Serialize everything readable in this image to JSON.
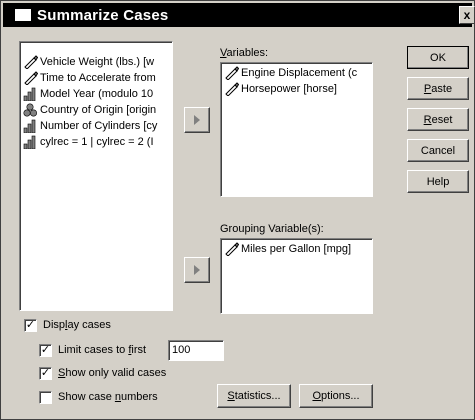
{
  "window": {
    "title": "Summarize Cases",
    "close_glyph": "x"
  },
  "source_list": {
    "items": [
      {
        "label": "Vehicle Weight (lbs.) [w",
        "icon": "scale-icon"
      },
      {
        "label": "Time to Accelerate from",
        "icon": "scale-icon"
      },
      {
        "label": "Model Year (modulo 10",
        "icon": "ordinal-icon"
      },
      {
        "label": "Country of Origin [origin",
        "icon": "nominal-icon"
      },
      {
        "label": "Number of Cylinders [cy",
        "icon": "ordinal-icon"
      },
      {
        "label": "cylrec = 1 | cylrec = 2 (I",
        "icon": "ordinal-icon"
      }
    ]
  },
  "variables": {
    "label_pre": "",
    "label_hot": "V",
    "label_post": "ariables:",
    "items": [
      {
        "label": "Engine Displacement (c",
        "icon": "scale-icon"
      },
      {
        "label": "Horsepower [horse]",
        "icon": "scale-icon"
      }
    ]
  },
  "grouping": {
    "label": "Grouping Variable(s):",
    "items": [
      {
        "label": "Miles per Gallon [mpg]",
        "icon": "scale-icon"
      }
    ]
  },
  "buttons": {
    "ok": "OK",
    "paste_hot": "P",
    "paste_rest": "aste",
    "reset_hot": "R",
    "reset_rest": "eset",
    "cancel": "Cancel",
    "help": "Help",
    "statistics_hot": "S",
    "statistics_rest": "tatistics...",
    "options_hot": "O",
    "options_rest": "ptions..."
  },
  "options": {
    "display_cases": {
      "pre": "Disp",
      "hot": "l",
      "post": "ay cases",
      "checked": true
    },
    "limit_cases": {
      "pre": "Limit cases to ",
      "hot": "f",
      "post": "irst",
      "checked": true,
      "value": "100"
    },
    "valid_only": {
      "pre": "",
      "hot": "S",
      "post": "how only valid cases",
      "checked": true
    },
    "case_numbers": {
      "pre": "Show case ",
      "hot": "n",
      "post": "umbers",
      "checked": false
    }
  },
  "colors": {
    "dialog_bg": "#d4d0c8",
    "titlebar_bg": "#000000",
    "list_bg": "#ffffff"
  }
}
